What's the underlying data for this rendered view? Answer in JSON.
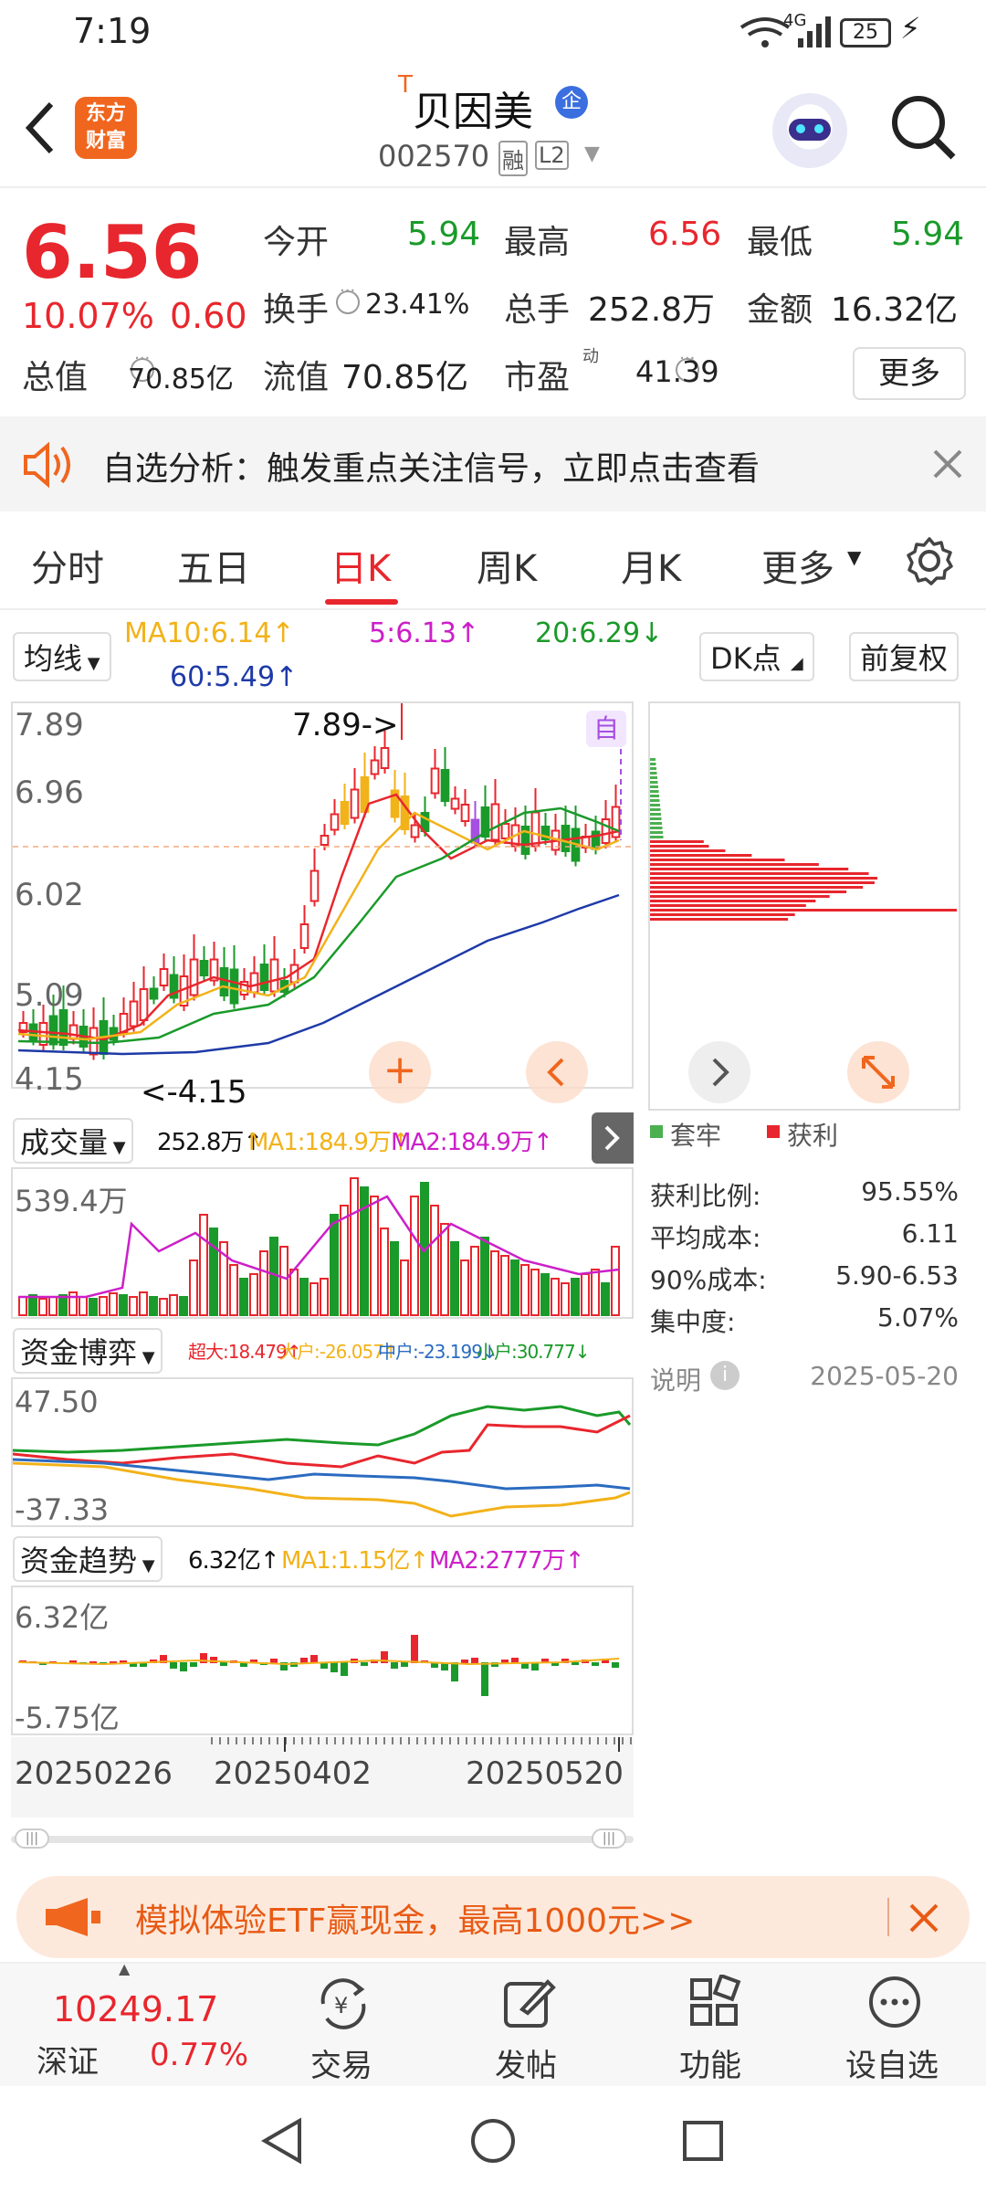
{
  "status_bar": {
    "time": "7:19",
    "network": "4G",
    "battery": "25"
  },
  "header": {
    "back_icon": "chevron-left-icon",
    "logo_line1": "东方",
    "logo_line2": "财富",
    "t_mark": "T",
    "stock_name": "贝因美",
    "badge": "企",
    "code": "002570",
    "tag1": "融",
    "tag2": "L2",
    "search_icon": "search-icon"
  },
  "quote": {
    "price": "6.56",
    "pct": "10.07%",
    "change": "0.60",
    "open_label": "今开",
    "open": "5.94",
    "high_label": "最高",
    "high": "6.56",
    "low_label": "最低",
    "low": "5.94",
    "turnover_label": "换手",
    "turnover": "23.41%",
    "vol_label": "总手",
    "vol": "252.8万",
    "amount_label": "金额",
    "amount": "16.32亿",
    "mcap_label": "总值",
    "mcap": "70.85亿",
    "float_label": "流值",
    "float": "70.85亿",
    "pe_label": "市盈",
    "pe_sup": "动",
    "pe": "41.39",
    "more": "更多"
  },
  "notice": {
    "text": "自选分析：触发重点关注信号，立即点击查看"
  },
  "tabs": [
    "分时",
    "五日",
    "日K",
    "周K",
    "月K",
    "更多"
  ],
  "active_tab": "日K",
  "ma": {
    "selector": "均线",
    "ma10": "MA10:6.14↑",
    "ma5": "5:6.13↑",
    "ma20": "20:6.29↓",
    "ma60": "60:5.49↑",
    "dk": "DK点",
    "fq": "前复权"
  },
  "kline": {
    "y_labels": [
      "7.89",
      "6.96",
      "6.02",
      "5.09",
      "4.15"
    ],
    "max_ann": "7.89->",
    "min_ann": "<-4.15",
    "self_tag": "自"
  },
  "volume": {
    "selector": "成交量",
    "v": "252.8万↑",
    "ma1": "MA1:184.9万↑",
    "ma2": "MA2:184.9万↑",
    "ymax": "539.4万"
  },
  "fund_game": {
    "selector": "资金博弈",
    "super": "超大:18.479↑",
    "big": "大户:-26.057↑",
    "mid": "中户:-23.199↓",
    "small": "小户:30.777↓",
    "ymax": "47.50",
    "ymin": "-37.33"
  },
  "fund_trend": {
    "selector": "资金趋势",
    "v": "6.32亿↑",
    "ma1": "MA1:1.15亿↑",
    "ma2": "MA2:2777万↑",
    "ymax": "6.32亿",
    "ymin": "-5.75亿"
  },
  "dates": [
    "20250226",
    "20250402",
    "20250520"
  ],
  "chips": {
    "legend_trap": "套牢",
    "legend_profit": "获利",
    "rows": [
      [
        "获利比例:",
        "95.55%"
      ],
      [
        "平均成本:",
        "6.11"
      ],
      [
        "90%成本:",
        "5.90-6.53"
      ],
      [
        "集中度:",
        "5.07%"
      ]
    ],
    "note": "说明",
    "date": "2025-05-20"
  },
  "ad": {
    "text": "模拟体验ETF赢现金，最高1000元>>"
  },
  "bottom_nav": {
    "index_value": "10249.17",
    "index_name": "深证",
    "index_pct": "0.77%",
    "items": [
      "交易",
      "发帖",
      "功能",
      "设自选"
    ]
  },
  "colors": {
    "up": "#e8262d",
    "down": "#1a9a2a",
    "accent": "#f0661e"
  }
}
